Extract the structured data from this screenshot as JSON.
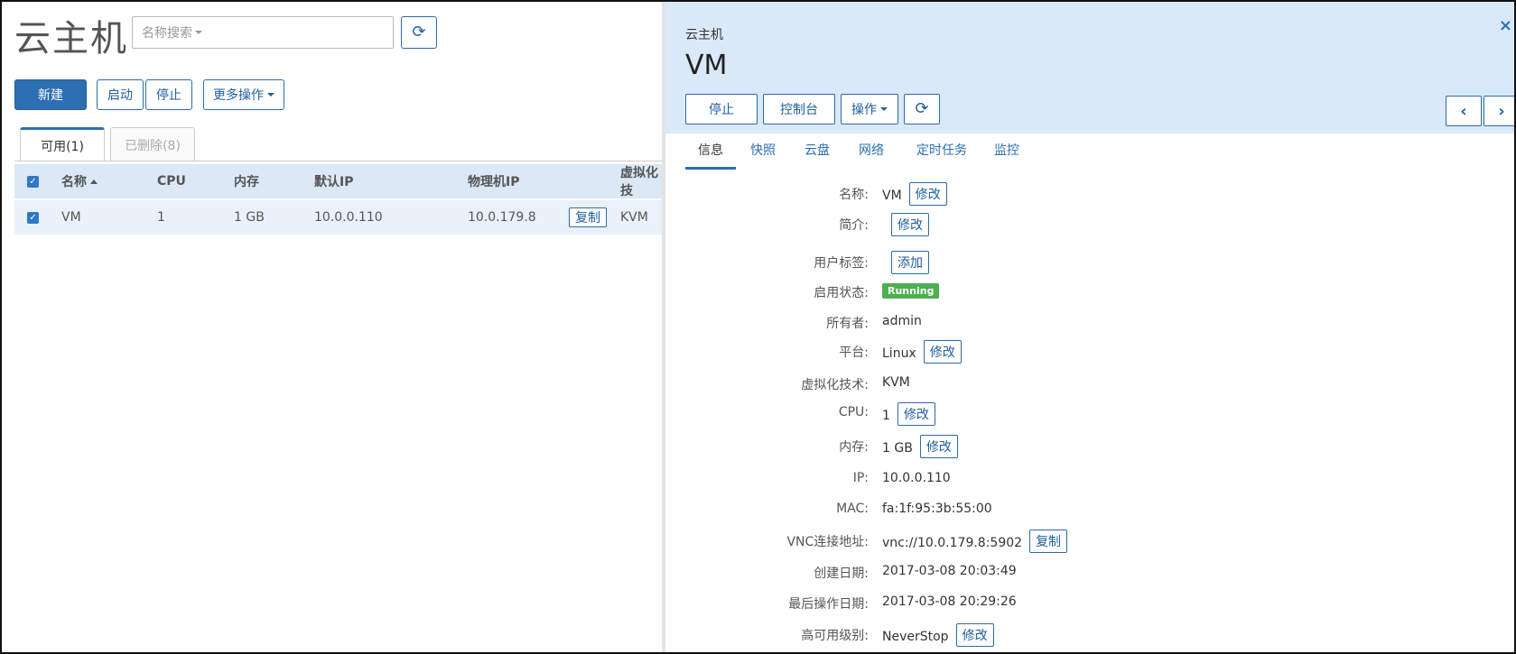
{
  "left": {
    "title": "云主机",
    "search_placeholder": "名称搜索",
    "toolbar": {
      "new": "新建",
      "start": "启动",
      "stop": "停止",
      "more": "更多操作"
    },
    "tabs": [
      {
        "label": "可用(1)",
        "active": true
      },
      {
        "label": "已删除(8)",
        "active": false
      }
    ],
    "table": {
      "headers": [
        "名称",
        "CPU",
        "内存",
        "默认IP",
        "物理机IP",
        "虚拟化技"
      ],
      "rows": [
        {
          "name": "VM",
          "cpu": "1",
          "memory": "1 GB",
          "ip": "10.0.0.110",
          "host_ip": "10.0.179.8",
          "copy_label": "复制",
          "hypervisor": "KVM"
        }
      ]
    }
  },
  "detail": {
    "subtitle": "云主机",
    "title": "VM",
    "close": "×",
    "actions": {
      "stop": "停止",
      "console": "控制台",
      "ops": "操作"
    },
    "tabs": [
      "信息",
      "快照",
      "云盘",
      "网络",
      "定时任务",
      "监控"
    ],
    "fields": {
      "name": {
        "label": "名称:",
        "value": "VM",
        "action": "修改"
      },
      "desc": {
        "label": "简介:",
        "action": "修改"
      },
      "tags": {
        "label": "用户标签:",
        "action": "添加"
      },
      "state": {
        "label": "启用状态:",
        "value": "Running"
      },
      "owner": {
        "label": "所有者:",
        "value": "admin"
      },
      "platform": {
        "label": "平台:",
        "value": "Linux",
        "action": "修改"
      },
      "virt": {
        "label": "虚拟化技术:",
        "value": "KVM"
      },
      "cpu": {
        "label": "CPU:",
        "value": "1",
        "action": "修改"
      },
      "memory": {
        "label": "内存:",
        "value": "1 GB",
        "action": "修改"
      },
      "ip": {
        "label": "IP:",
        "value": "10.0.0.110"
      },
      "mac": {
        "label": "MAC:",
        "value": "fa:1f:95:3b:55:00"
      },
      "vnc": {
        "label": "VNC连接地址:",
        "value": "vnc://10.0.179.8:5902",
        "action": "复制"
      },
      "created": {
        "label": "创建日期:",
        "value": "2017-03-08 20:03:49"
      },
      "lastop": {
        "label": "最后操作日期:",
        "value": "2017-03-08 20:29:26"
      },
      "ha": {
        "label": "高可用级别:",
        "value": "NeverStop",
        "action": "修改"
      }
    }
  },
  "colors": {
    "accent": "#2c6fb3",
    "header_bg": "#dae9f8",
    "running": "#4caf50"
  }
}
